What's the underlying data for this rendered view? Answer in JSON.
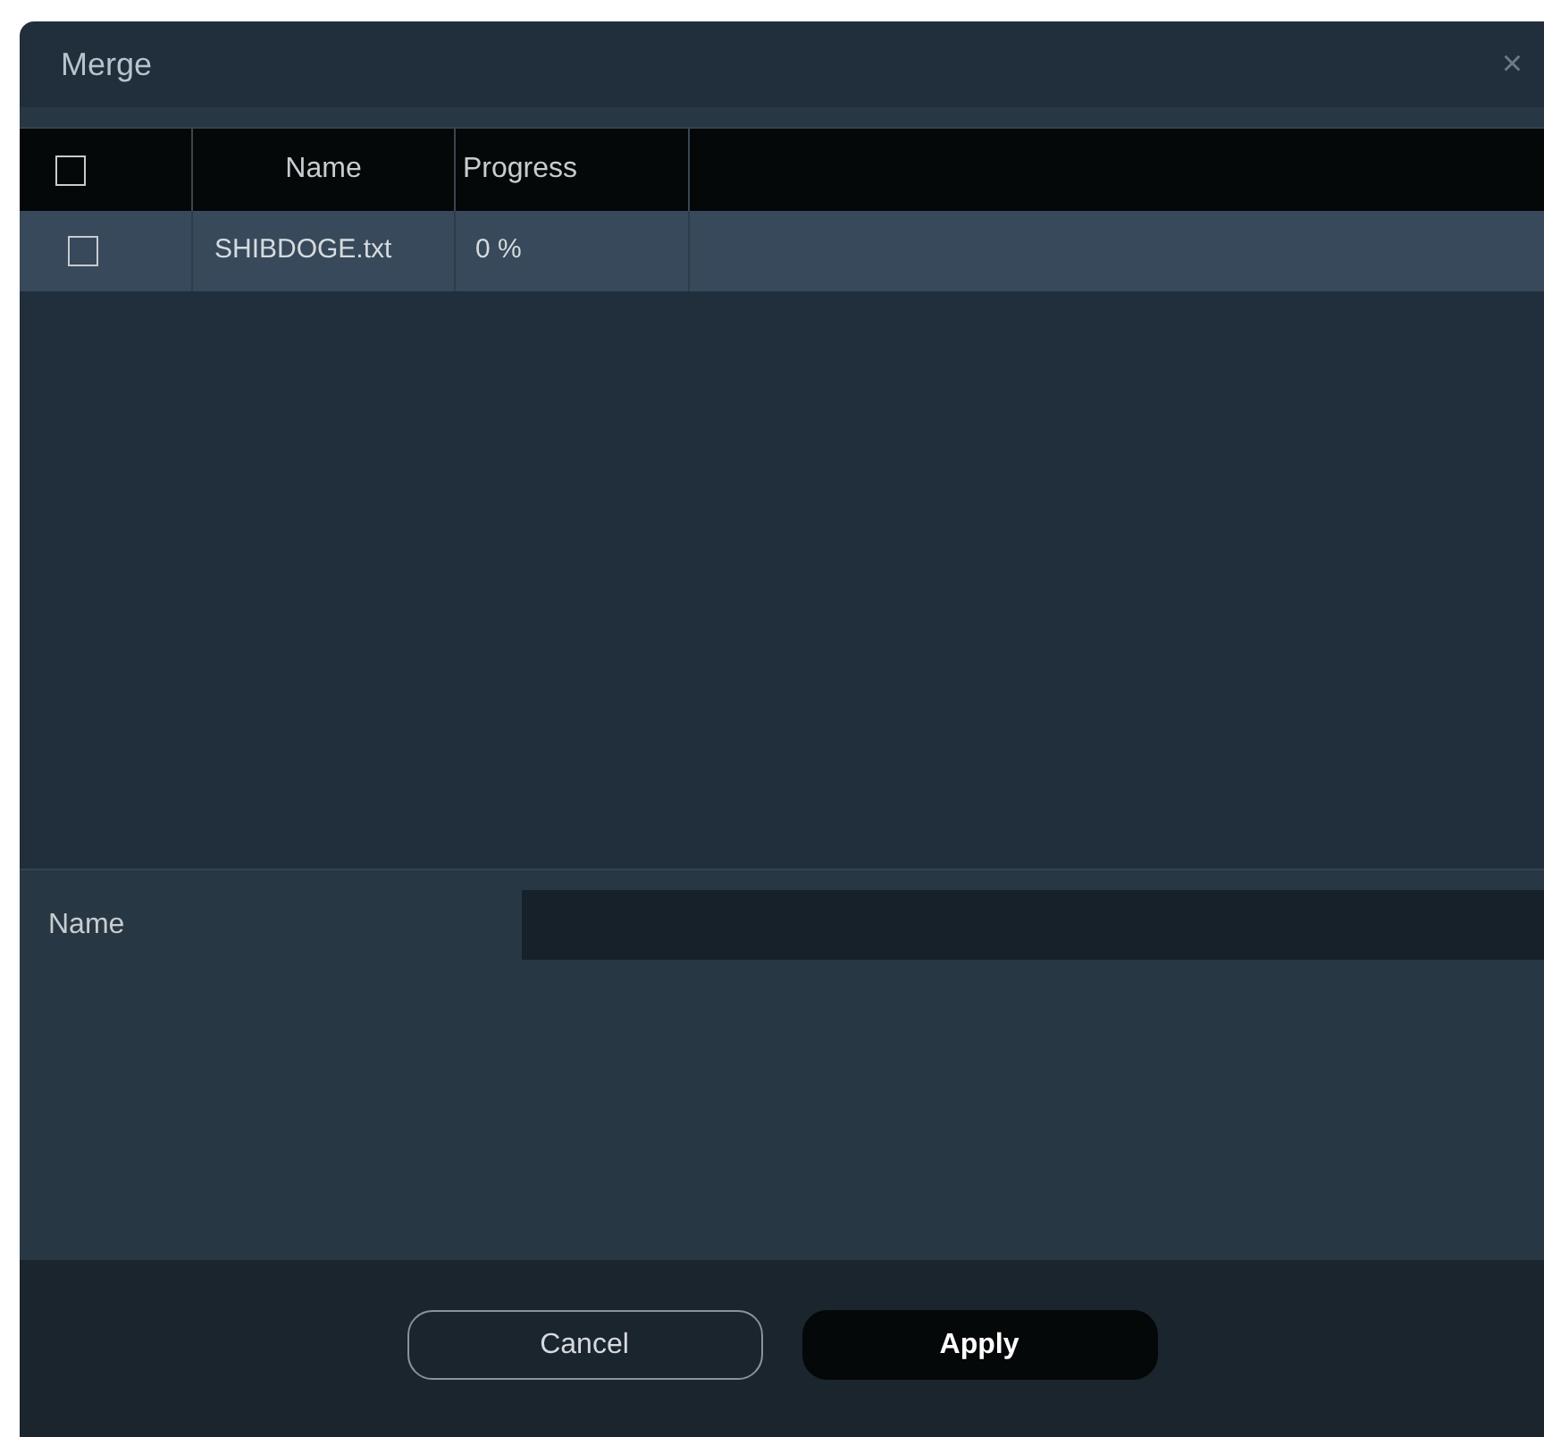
{
  "window": {
    "title": "Merge",
    "close": "×"
  },
  "table": {
    "select_all": {
      "checked": false
    },
    "columns": [
      "Name",
      "Progress"
    ],
    "rows": [
      {
        "checked": false,
        "selected": true,
        "name": "SHIBDOGE.txt",
        "progress": "0 %"
      }
    ]
  },
  "form": {
    "label": "Name"
  },
  "buttons": [
    {
      "label": "Cancel",
      "kind": "secondary"
    },
    {
      "label": "Apply",
      "kind": "primary"
    }
  ]
}
